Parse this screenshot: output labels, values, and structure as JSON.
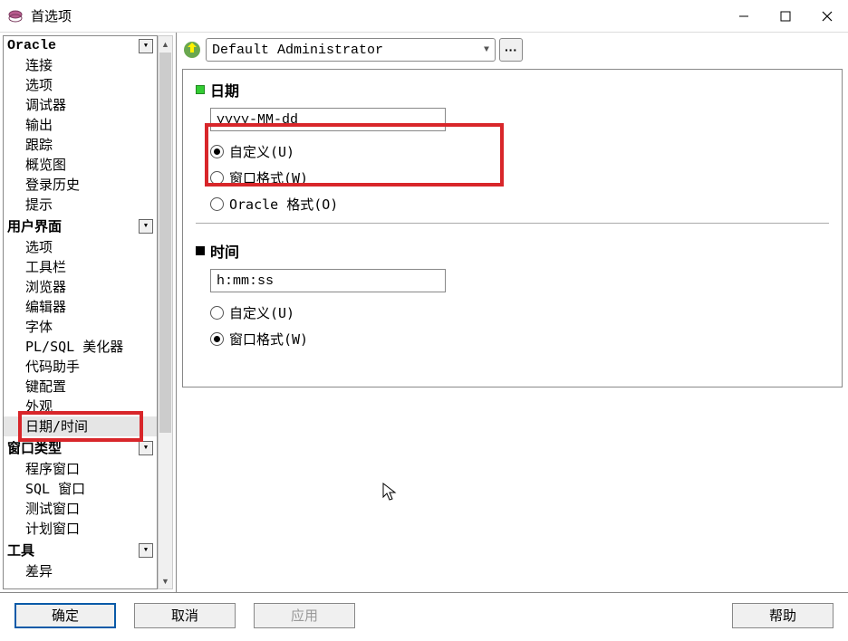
{
  "window": {
    "title": "首选项"
  },
  "sidebar": {
    "sections": [
      {
        "header": "Oracle",
        "items": [
          "连接",
          "选项",
          "调试器",
          "输出",
          "跟踪",
          "概览图",
          "登录历史",
          "提示"
        ]
      },
      {
        "header": "用户界面",
        "items": [
          "选项",
          "工具栏",
          "浏览器",
          "编辑器",
          "字体",
          "PL/SQL 美化器",
          "代码助手",
          "键配置",
          "外观",
          "日期/时间"
        ]
      },
      {
        "header": "窗口类型",
        "items": [
          "程序窗口",
          "SQL 窗口",
          "测试窗口",
          "计划窗口"
        ]
      },
      {
        "header": "工具",
        "items": [
          "差异",
          ""
        ]
      }
    ],
    "selected": "日期/时间"
  },
  "profile": {
    "label": "Default Administrator"
  },
  "groups": {
    "date": {
      "title": "日期",
      "value": "yyyy-MM-dd",
      "options": [
        "自定义(U)",
        "窗口格式(W)",
        "Oracle 格式(O)"
      ],
      "selected": 0
    },
    "time": {
      "title": "时间",
      "value": "h:mm:ss",
      "options": [
        "自定义(U)",
        "窗口格式(W)"
      ],
      "selected": 1
    }
  },
  "buttons": {
    "ok": "确定",
    "cancel": "取消",
    "apply": "应用",
    "help": "帮助"
  }
}
